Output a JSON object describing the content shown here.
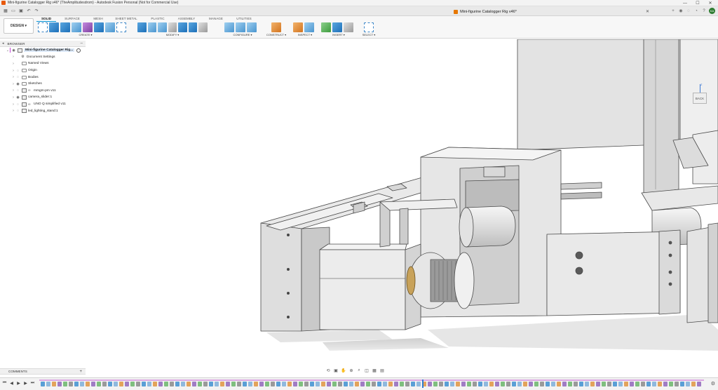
{
  "window": {
    "title": "Mini-figurine Catalogger Rig v46* (TheAmplitudesdrom) - Autodesk Fusion Personal (Not for Commercial Use)",
    "controls": [
      "—",
      "☐",
      "✕"
    ]
  },
  "tabbar": {
    "document_title": "Mini-figurine Catalogger Rig v46*",
    "close_glyph": "✕",
    "avatar_initials": "KA"
  },
  "toolbar": {
    "design_label": "DESIGN ▾",
    "workspace_tabs": [
      "SOLID",
      "SURFACE",
      "MESH",
      "SHEET METAL",
      "PLASTIC",
      "ASSEMBLY",
      "MANAGE",
      "UTILITIES"
    ],
    "groups": {
      "create": "CREATE ▾",
      "modify": "MODIFY ▾",
      "configure": "CONFIGURE ▾",
      "construct": "CONSTRUCT ▾",
      "inspect": "INSPECT ▾",
      "insert": "INSERT ▾",
      "select": "SELECT ▾"
    }
  },
  "browser": {
    "title": "BROWSER",
    "collapse_glyph": "–",
    "root": "Mini-figurine Catalogger Rig...",
    "items": [
      {
        "label": "Document Settings"
      },
      {
        "label": "Named Views"
      },
      {
        "label": "Origin"
      },
      {
        "label": "Bodies"
      },
      {
        "label": "Sketches"
      },
      {
        "label": "mmgm-pm v11"
      },
      {
        "label": "camera_slider:1"
      },
      {
        "label": "UNO Q simplified v11"
      },
      {
        "label": "led_lighting_stand:1"
      }
    ]
  },
  "viewcube": {
    "face_label": "BACK",
    "axis_label": "Z"
  },
  "comments": {
    "title": "COMMENTS",
    "add_glyph": "+"
  },
  "timeline": {
    "play_controls": [
      "⏮",
      "◀",
      "▶",
      "▶",
      "⏭"
    ],
    "settings_glyph": "⚙"
  },
  "colors": {
    "accent": "#0696d7",
    "model_face": "#ececec",
    "model_edge": "#4a4a4a"
  }
}
